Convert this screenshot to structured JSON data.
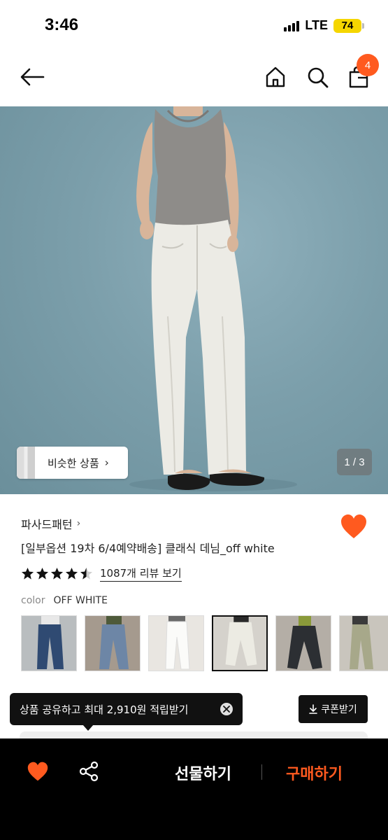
{
  "status_bar": {
    "time": "3:46",
    "network": "LTE",
    "battery": "74"
  },
  "header": {
    "icons": [
      "back-arrow-icon",
      "home-icon",
      "search-icon",
      "shopping-bag-icon"
    ],
    "cart_count": "4"
  },
  "hero": {
    "similar_label": "비슷한 상품",
    "similar_chevron": "›",
    "counter": "1 / 3"
  },
  "product": {
    "brand": "파사드패턴",
    "brand_chevron": "›",
    "title": "[일부옵션 19차 6/4예약배송] 클래식 데님_off white",
    "rating": 4.5,
    "review_link": "1087개 리뷰 보기",
    "color_label": "color",
    "color_value": "OFF WHITE",
    "liked": true
  },
  "swatches": [
    {
      "name": "dark-blue-denim",
      "selected": false
    },
    {
      "name": "light-blue-denim",
      "selected": false
    },
    {
      "name": "white-denim",
      "selected": false
    },
    {
      "name": "off-white-denim",
      "selected": true
    },
    {
      "name": "black-denim",
      "selected": false
    },
    {
      "name": "olive-denim",
      "selected": false
    }
  ],
  "share_tooltip": {
    "text": "상품 공유하고 최대 2,910원 적립받기"
  },
  "coupon": {
    "label": "쿠폰받기"
  },
  "bottom_bar": {
    "gift_label": "선물하기",
    "buy_label": "구매하기"
  },
  "colors": {
    "accent": "#ff5a1f",
    "dark": "#111111",
    "hero_bg": "#7c9fab"
  }
}
